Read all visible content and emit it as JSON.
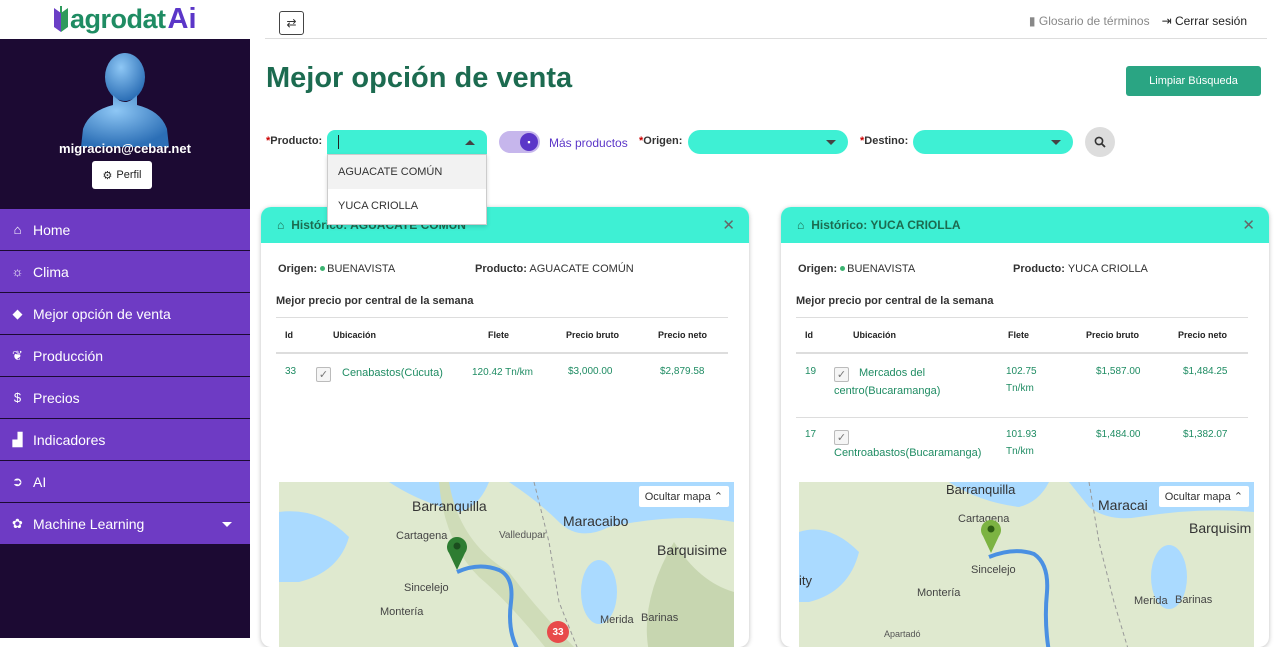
{
  "brand": {
    "word": "agrodat",
    "ai": "Ai"
  },
  "topbar": {
    "glossary": "Glosario de términos",
    "logout": "Cerrar sesión"
  },
  "profile": {
    "email": "migracion@cebar.net",
    "button": "Perfil"
  },
  "menu": [
    {
      "label": "Home",
      "icon": "home-icon"
    },
    {
      "label": "Clima",
      "icon": "sun-icon"
    },
    {
      "label": "Mejor opción de venta",
      "icon": "tag-icon"
    },
    {
      "label": "Producción",
      "icon": "leaf-icon"
    },
    {
      "label": "Precios",
      "icon": "dollar-icon"
    },
    {
      "label": "Indicadores",
      "icon": "chart-icon"
    },
    {
      "label": "AI",
      "icon": "arrow-circle-icon"
    },
    {
      "label": "Machine Learning",
      "icon": "brain-icon"
    }
  ],
  "page": {
    "title": "Mejor opción de venta",
    "clear_button": "Limpiar Búsqueda"
  },
  "filters": {
    "producto_label": "Producto:",
    "origen_label": "Origen:",
    "destino_label": "Destino:",
    "mas_productos": "Más productos",
    "required_mark": "*"
  },
  "dropdown": {
    "options": [
      "AGUACATE COMÚN",
      "YUCA CRIOLLA"
    ]
  },
  "cards": [
    {
      "title": "Histórico: AGUACATE COMÚN",
      "origen_label": "Origen:",
      "origen": "BUENAVISTA",
      "producto_label": "Producto:",
      "producto": "AGUACATE COMÚN",
      "subtitle": "Mejor precio por central de la semana",
      "headers": [
        "Id",
        "Ubicación",
        "Flete",
        "Precio bruto",
        "Precio neto"
      ],
      "rows": [
        {
          "id": "33",
          "ubicacion": "Cenabastos(Cúcuta)",
          "flete": "120.42 Tn/km",
          "bruto": "$3,000.00",
          "neto": "$2,879.58"
        }
      ],
      "map_toggle": "Ocultar mapa",
      "map_labels": [
        "Barranquilla",
        "Maracaibo",
        "Cartagena",
        "Valledupar",
        "Barquisime",
        "Sincelejo",
        "Montería",
        "Merida",
        "Barinas"
      ],
      "marker": "33"
    },
    {
      "title": "Histórico: YUCA CRIOLLA",
      "origen_label": "Origen:",
      "origen": "BUENAVISTA",
      "producto_label": "Producto:",
      "producto": "YUCA CRIOLLA",
      "subtitle": "Mejor precio por central de la semana",
      "headers": [
        "Id",
        "Ubicación",
        "Flete",
        "Precio bruto",
        "Precio neto"
      ],
      "rows": [
        {
          "id": "19",
          "ubicacion1": "Mercados del",
          "ubicacion2": "centro(Bucaramanga)",
          "flete1": "102.75",
          "flete2": "Tn/km",
          "bruto": "$1,587.00",
          "neto": "$1,484.25"
        },
        {
          "id": "17",
          "ubicacion1": "Centroabastos(Bucaramanga)",
          "flete1": "101.93",
          "flete2": "Tn/km",
          "bruto": "$1,484.00",
          "neto": "$1,382.07"
        }
      ],
      "map_toggle": "Ocultar mapa",
      "map_labels": [
        "Barranquilla",
        "Maracai",
        "Cartagena",
        "Barquisim",
        "ity",
        "Sincelejo",
        "Montería",
        "Merida",
        "Barinas",
        "Apartadó"
      ]
    }
  ]
}
